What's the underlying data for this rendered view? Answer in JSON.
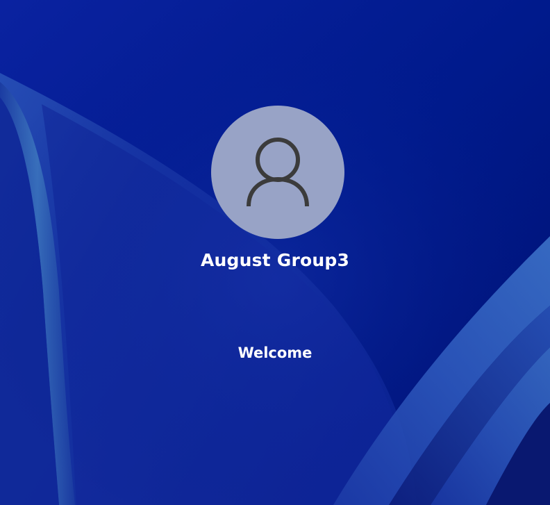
{
  "login": {
    "user_name": "August Group3",
    "status_text": "Welcome"
  },
  "icons": {
    "avatar": "user-icon"
  },
  "colors": {
    "background": "#001a8c",
    "avatar_circle": "#98a3c6",
    "avatar_glyph": "#3b3b3b",
    "text": "#ffffff"
  }
}
